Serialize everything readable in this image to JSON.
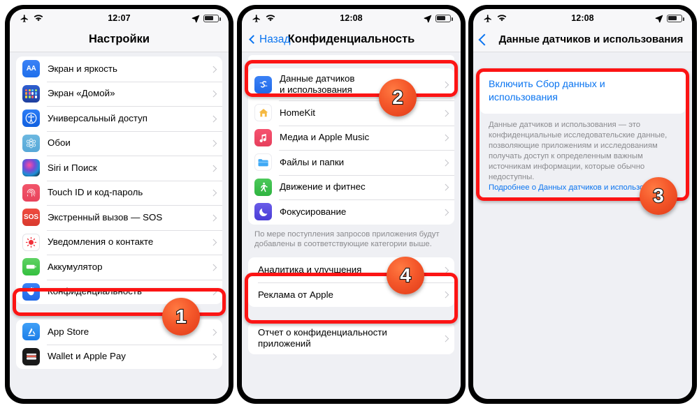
{
  "panels": [
    {
      "id": "settings",
      "statusbar": {
        "time": "12:07",
        "airplane_icon": "airplane-icon",
        "wifi_icon": "wifi-icon",
        "location_icon": "location-arrow-icon",
        "battery_icon": "battery-icon"
      },
      "nav": {
        "title": "Настройки",
        "back_label": ""
      },
      "groups": [
        {
          "rows": [
            {
              "label": "Экран и яркость",
              "icon": "display-brightness-icon"
            },
            {
              "label": "Экран «Домой»",
              "icon": "home-screen-icon"
            },
            {
              "label": "Универсальный доступ",
              "icon": "accessibility-icon"
            },
            {
              "label": "Обои",
              "icon": "wallpaper-icon"
            },
            {
              "label": "Siri и Поиск",
              "icon": "siri-icon"
            },
            {
              "label": "Touch ID и код-пароль",
              "icon": "touch-id-icon"
            },
            {
              "label": "Экстренный вызов — SOS",
              "icon": "sos-icon"
            },
            {
              "label": "Уведомления о контакте",
              "icon": "contact-notification-icon"
            },
            {
              "label": "Аккумулятор",
              "icon": "battery-settings-icon"
            },
            {
              "label": "Конфиденциальность",
              "icon": "privacy-hand-icon"
            }
          ]
        },
        {
          "rows": [
            {
              "label": "App Store",
              "icon": "app-store-icon"
            },
            {
              "label": "Wallet и Apple Pay",
              "icon": "wallet-icon"
            }
          ]
        }
      ]
    },
    {
      "id": "privacy",
      "statusbar": {
        "time": "12:08"
      },
      "nav": {
        "title": "Конфиденциальность",
        "back_label": "Назад"
      },
      "groups": [
        {
          "rows": [
            {
              "label": "Данные датчиков\nи использования",
              "icon": "sensor-usage-icon"
            },
            {
              "label": "HomeKit",
              "icon": "homekit-icon"
            },
            {
              "label": "Медиа и Apple Music",
              "icon": "media-music-icon"
            },
            {
              "label": "Файлы и папки",
              "icon": "files-folders-icon"
            },
            {
              "label": "Движение и фитнес",
              "icon": "motion-fitness-icon"
            },
            {
              "label": "Фокусирование",
              "icon": "focus-icon"
            }
          ]
        }
      ],
      "footnote": "По мере поступления запросов приложения будут добавлены в соответствующие категории выше.",
      "group2": [
        {
          "label": "Аналитика и улучшения",
          "icon": ""
        },
        {
          "label": "Реклама от Apple",
          "icon": ""
        }
      ],
      "group3": [
        {
          "label": "Отчет о конфиденциальности\nприложений",
          "icon": ""
        }
      ]
    },
    {
      "id": "sensor-usage",
      "statusbar": {
        "time": "12:08"
      },
      "nav": {
        "title": "Данные датчиков и использования",
        "back_label": ""
      },
      "detail": {
        "link": "Включить Сбор данных и использования",
        "description": "Данные датчиков и использования — это конфиденциальные исследовательские данные, позволяющие приложениям и исследованиям получать доступ к определенным важным источникам информации, которые обычно недоступны.",
        "more_link": "Подробнее о Данных датчиков и использования..."
      }
    }
  ],
  "badges": [
    {
      "number": "1"
    },
    {
      "number": "2"
    },
    {
      "number": "3"
    },
    {
      "number": "4"
    }
  ],
  "colors": {
    "highlight": "#fc1414",
    "badge": "#f4572a",
    "link": "#0a74f0",
    "screen_bg": "#eff0f4"
  }
}
